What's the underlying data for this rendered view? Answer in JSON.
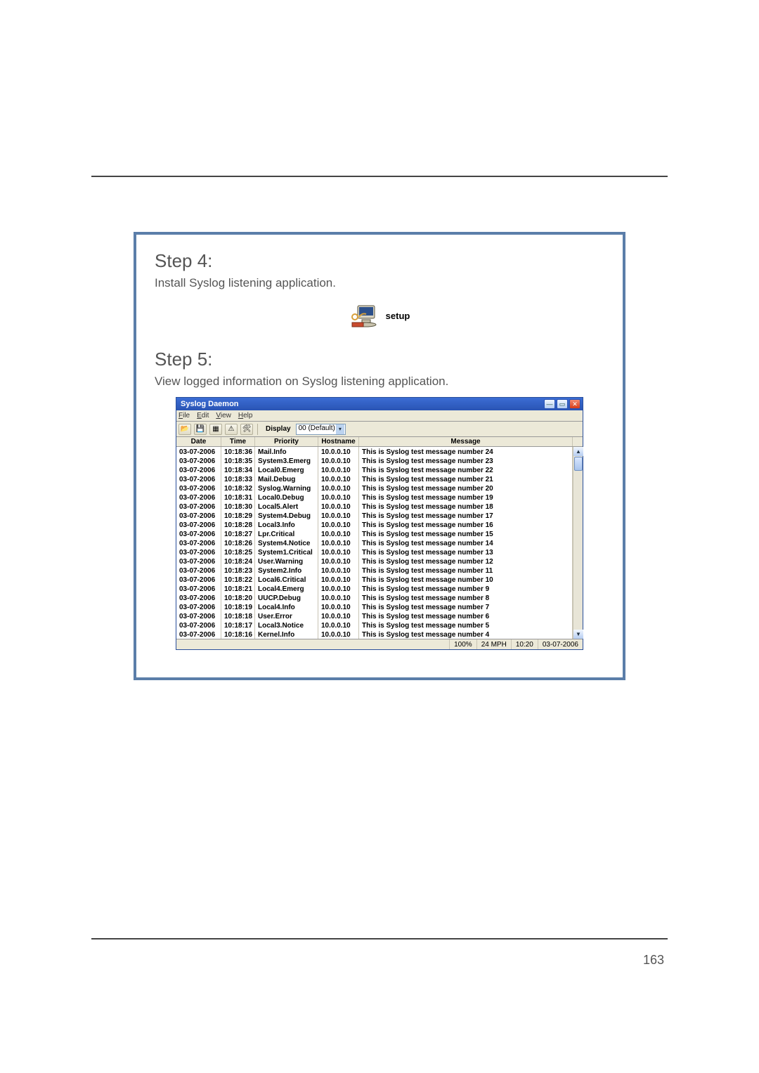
{
  "page": {
    "number": "163"
  },
  "step4": {
    "title": "Step 4:",
    "desc": "Install Syslog listening application.",
    "icon_label": "setup"
  },
  "step5": {
    "title": "Step 5:",
    "desc": "View logged information on Syslog listening application."
  },
  "syslog": {
    "title": "Syslog Daemon",
    "menu": {
      "file": "File",
      "edit": "Edit",
      "view": "View",
      "help": "Help"
    },
    "toolbar": {
      "display_label": "Display",
      "display_value": "00 (Default)"
    },
    "columns": {
      "date": "Date",
      "time": "Time",
      "priority": "Priority",
      "hostname": "Hostname",
      "message": "Message"
    },
    "rows": [
      {
        "date": "03-07-2006",
        "time": "10:18:36",
        "priority": "Mail.Info",
        "host": "10.0.0.10",
        "msg": "This is Syslog test message number 24"
      },
      {
        "date": "03-07-2006",
        "time": "10:18:35",
        "priority": "System3.Emerg",
        "host": "10.0.0.10",
        "msg": "This is Syslog test message number 23"
      },
      {
        "date": "03-07-2006",
        "time": "10:18:34",
        "priority": "Local0.Emerg",
        "host": "10.0.0.10",
        "msg": "This is Syslog test message number 22"
      },
      {
        "date": "03-07-2006",
        "time": "10:18:33",
        "priority": "Mail.Debug",
        "host": "10.0.0.10",
        "msg": "This is Syslog test message number 21"
      },
      {
        "date": "03-07-2006",
        "time": "10:18:32",
        "priority": "Syslog.Warning",
        "host": "10.0.0.10",
        "msg": "This is Syslog test message number 20"
      },
      {
        "date": "03-07-2006",
        "time": "10:18:31",
        "priority": "Local0.Debug",
        "host": "10.0.0.10",
        "msg": "This is Syslog test message number 19"
      },
      {
        "date": "03-07-2006",
        "time": "10:18:30",
        "priority": "Local5.Alert",
        "host": "10.0.0.10",
        "msg": "This is Syslog test message number 18"
      },
      {
        "date": "03-07-2006",
        "time": "10:18:29",
        "priority": "System4.Debug",
        "host": "10.0.0.10",
        "msg": "This is Syslog test message number 17"
      },
      {
        "date": "03-07-2006",
        "time": "10:18:28",
        "priority": "Local3.Info",
        "host": "10.0.0.10",
        "msg": "This is Syslog test message number 16"
      },
      {
        "date": "03-07-2006",
        "time": "10:18:27",
        "priority": "Lpr.Critical",
        "host": "10.0.0.10",
        "msg": "This is Syslog test message number 15"
      },
      {
        "date": "03-07-2006",
        "time": "10:18:26",
        "priority": "System4.Notice",
        "host": "10.0.0.10",
        "msg": "This is Syslog test message number 14"
      },
      {
        "date": "03-07-2006",
        "time": "10:18:25",
        "priority": "System1.Critical",
        "host": "10.0.0.10",
        "msg": "This is Syslog test message number 13"
      },
      {
        "date": "03-07-2006",
        "time": "10:18:24",
        "priority": "User.Warning",
        "host": "10.0.0.10",
        "msg": "This is Syslog test message number 12"
      },
      {
        "date": "03-07-2006",
        "time": "10:18:23",
        "priority": "System2.Info",
        "host": "10.0.0.10",
        "msg": "This is Syslog test message number 11"
      },
      {
        "date": "03-07-2006",
        "time": "10:18:22",
        "priority": "Local6.Critical",
        "host": "10.0.0.10",
        "msg": "This is Syslog test message number 10"
      },
      {
        "date": "03-07-2006",
        "time": "10:18:21",
        "priority": "Local4.Emerg",
        "host": "10.0.0.10",
        "msg": "This is Syslog test message number 9"
      },
      {
        "date": "03-07-2006",
        "time": "10:18:20",
        "priority": "UUCP.Debug",
        "host": "10.0.0.10",
        "msg": "This is Syslog test message number 8"
      },
      {
        "date": "03-07-2006",
        "time": "10:18:19",
        "priority": "Local4.Info",
        "host": "10.0.0.10",
        "msg": "This is Syslog test message number 7"
      },
      {
        "date": "03-07-2006",
        "time": "10:18:18",
        "priority": "User.Error",
        "host": "10.0.0.10",
        "msg": "This is Syslog test message number 6"
      },
      {
        "date": "03-07-2006",
        "time": "10:18:17",
        "priority": "Local3.Notice",
        "host": "10.0.0.10",
        "msg": "This is Syslog test message number 5"
      },
      {
        "date": "03-07-2006",
        "time": "10:18:16",
        "priority": "Kernel.Info",
        "host": "10.0.0.10",
        "msg": "This is Syslog test message number 4"
      }
    ],
    "status": {
      "percent": "100%",
      "mph": "24 MPH",
      "time": "10:20",
      "date": "03-07-2006"
    }
  }
}
